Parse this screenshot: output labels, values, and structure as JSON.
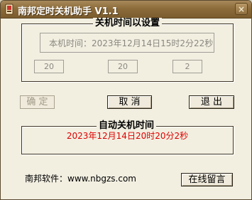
{
  "window": {
    "title": "南邦定时关机助手 V1.1",
    "close_glyph": "×"
  },
  "settings_group": {
    "title": "关机时间以设置",
    "current_time_text": "本机时间：2023年12月14日15时2分22秒",
    "hour_value": "20",
    "minute_value": "20",
    "second_value": "2"
  },
  "buttons": {
    "confirm_label": "确  定",
    "cancel_label": "取  消",
    "exit_label": "退  出",
    "message_label": "在线留言"
  },
  "auto_group": {
    "title": "自动关机时间",
    "shutdown_time_text": "2023年12月14日20时20分2秒"
  },
  "footer": {
    "site_text": "南邦软件：www.nbgzs.com"
  }
}
